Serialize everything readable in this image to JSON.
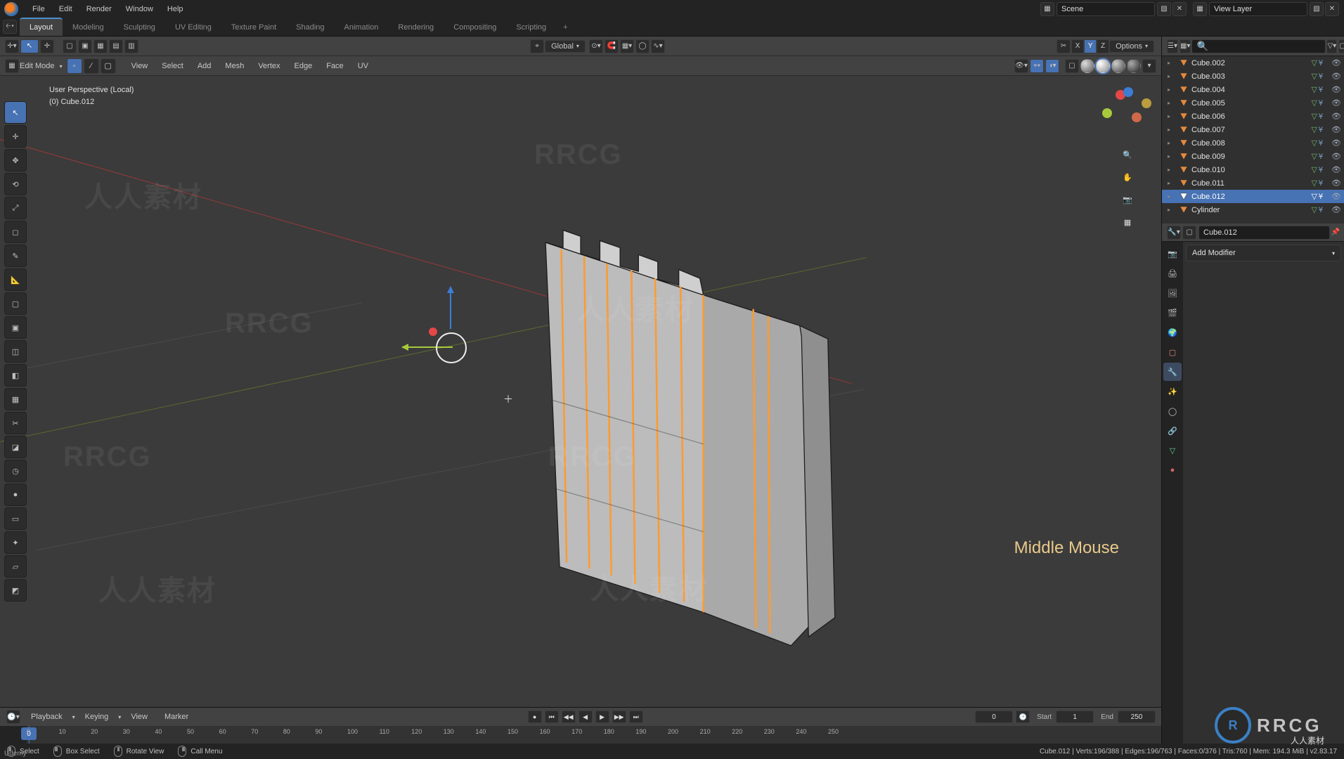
{
  "top_menu": {
    "file": "File",
    "edit": "Edit",
    "render": "Render",
    "window": "Window",
    "help": "Help"
  },
  "scene_field": "Scene",
  "viewlayer_field": "View Layer",
  "workspaces": [
    {
      "id": "layout",
      "label": "Layout",
      "active": true
    },
    {
      "id": "modeling",
      "label": "Modeling"
    },
    {
      "id": "sculpting",
      "label": "Sculpting"
    },
    {
      "id": "uv",
      "label": "UV Editing"
    },
    {
      "id": "texpaint",
      "label": "Texture Paint"
    },
    {
      "id": "shading",
      "label": "Shading"
    },
    {
      "id": "anim",
      "label": "Animation"
    },
    {
      "id": "rendering",
      "label": "Rendering"
    },
    {
      "id": "compositing",
      "label": "Compositing"
    },
    {
      "id": "scripting",
      "label": "Scripting"
    }
  ],
  "headerbar": {
    "mode": "Edit Mode",
    "orientation": "Global",
    "xyz": {
      "x": "X",
      "y": "Y",
      "z": "Z"
    },
    "options": "Options"
  },
  "editmenu": {
    "view": "View",
    "select": "Select",
    "add": "Add",
    "mesh": "Mesh",
    "vertex": "Vertex",
    "edge": "Edge",
    "face": "Face",
    "uv": "UV"
  },
  "viewport": {
    "perspective": "User Perspective (Local)",
    "object": "(0) Cube.012",
    "keycast": "Middle Mouse"
  },
  "tools": [
    {
      "id": "tweak",
      "g": "↖",
      "active": true
    },
    {
      "id": "cursor",
      "g": "✛"
    },
    {
      "id": "move",
      "g": "✥"
    },
    {
      "id": "rotate",
      "g": "⟲"
    },
    {
      "id": "scale",
      "g": "⤢"
    },
    {
      "id": "transform",
      "g": "◻"
    },
    {
      "id": "annotate",
      "g": "✎"
    },
    {
      "id": "measure",
      "g": "📐"
    },
    {
      "id": "add-cube",
      "g": "▢"
    },
    {
      "id": "extrude-r",
      "g": "▣"
    },
    {
      "id": "inset",
      "g": "◫"
    },
    {
      "id": "bevel",
      "g": "◧"
    },
    {
      "id": "loopcut",
      "g": "▦"
    },
    {
      "id": "knife",
      "g": "✂"
    },
    {
      "id": "polybuild",
      "g": "◪"
    },
    {
      "id": "spin",
      "g": "◷"
    },
    {
      "id": "smooth",
      "g": "●"
    },
    {
      "id": "slide",
      "g": "▭"
    },
    {
      "id": "shrink",
      "g": "✦"
    },
    {
      "id": "shear",
      "g": "▱"
    },
    {
      "id": "rip",
      "g": "◩"
    }
  ],
  "outliner": [
    {
      "name": "Cube.002"
    },
    {
      "name": "Cube.003"
    },
    {
      "name": "Cube.004"
    },
    {
      "name": "Cube.005"
    },
    {
      "name": "Cube.006"
    },
    {
      "name": "Cube.007"
    },
    {
      "name": "Cube.008"
    },
    {
      "name": "Cube.009"
    },
    {
      "name": "Cube.010"
    },
    {
      "name": "Cube.011"
    },
    {
      "name": "Cube.012",
      "active": true
    },
    {
      "name": "Cylinder"
    }
  ],
  "props": {
    "object": "Cube.012",
    "add_modifier": "Add Modifier"
  },
  "timeline": {
    "playback": "Playback",
    "keying": "Keying",
    "view": "View",
    "marker": "Marker",
    "current": "0",
    "start_label": "Start",
    "start": "1",
    "end_label": "End",
    "end": "250",
    "frames": [
      "0",
      "10",
      "20",
      "30",
      "40",
      "50",
      "60",
      "70",
      "80",
      "90",
      "100",
      "110",
      "120",
      "130",
      "140",
      "150",
      "160",
      "170",
      "180",
      "190",
      "200",
      "210",
      "220",
      "230",
      "240",
      "250"
    ]
  },
  "statusbar": {
    "select": "Select",
    "box": "Box Select",
    "rotate": "Rotate View",
    "menu": "Call Menu",
    "stats": "Cube.012 | Verts:196/388 | Edges:196/763 | Faces:0/376 | Tris:760 | Mem: 194.3 MiB | v2.83.17"
  },
  "udemy": "Udemy"
}
